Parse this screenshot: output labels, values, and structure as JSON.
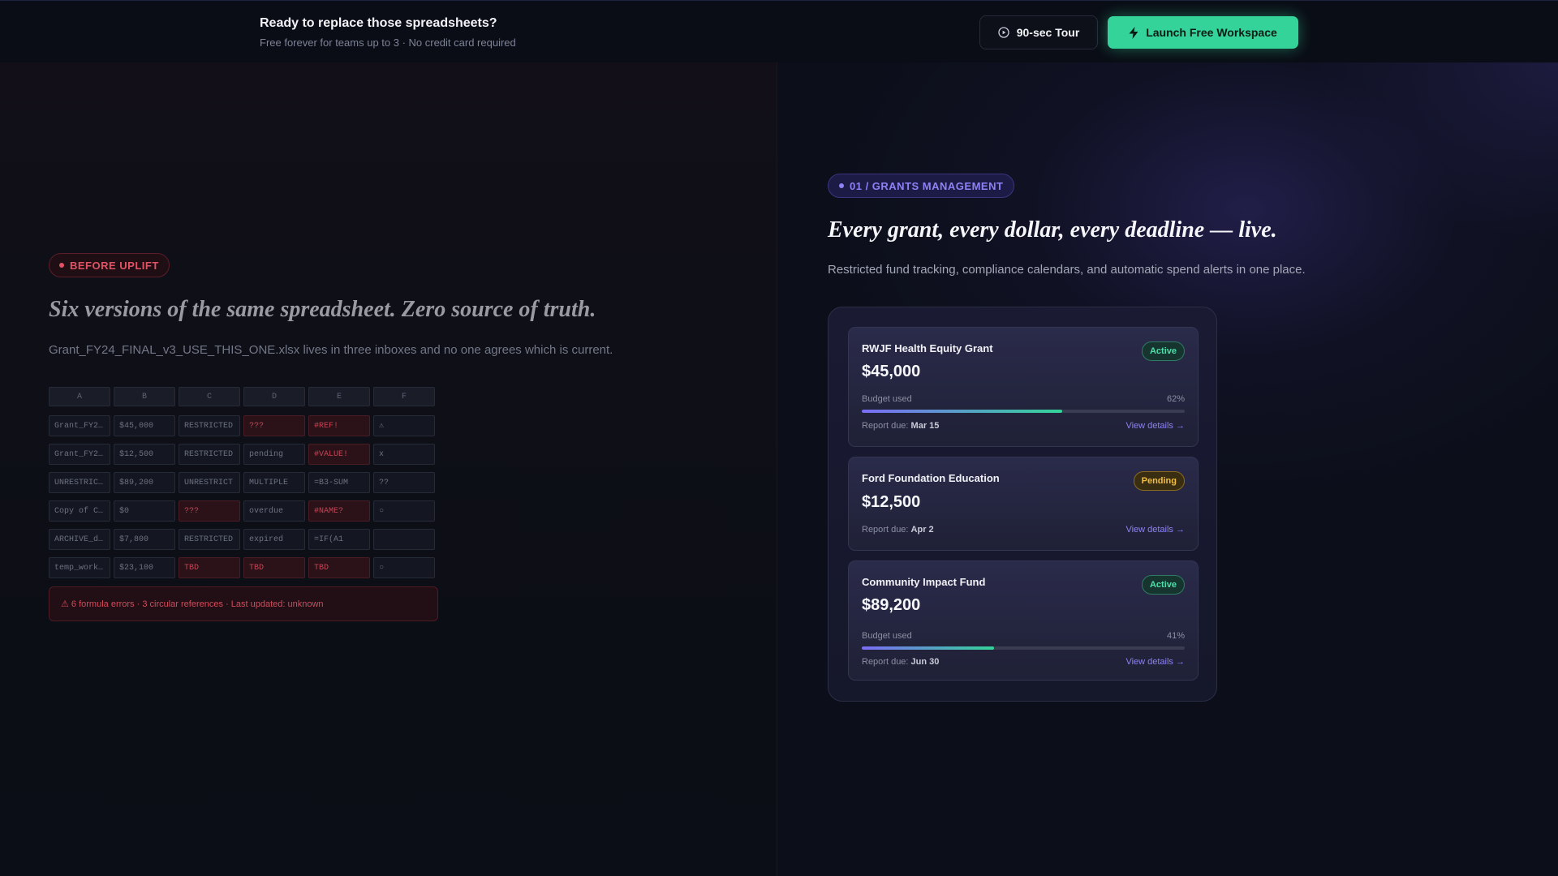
{
  "topbar": {
    "title": "Ready to replace those spreadsheets?",
    "subtitle": "Free forever for teams up to 3 · No credit card required",
    "tour_label": "90-sec Tour",
    "launch_label": "Launch Free Workspace",
    "accent": "#34d399"
  },
  "before": {
    "pill": "BEFORE UPLIFT",
    "heading": "Six versions of the same spreadsheet. Zero source of truth.",
    "body": "Grant_FY24_FINAL_v3_USE_THIS_ONE.xlsx lives in three inboxes and no one agrees which is current.",
    "columns": [
      "A",
      "B",
      "C",
      "D",
      "E",
      "F"
    ],
    "rows": [
      [
        "Grant_FY2…",
        "$45,000",
        "RESTRICTED",
        "???",
        "#REF!",
        "⚠"
      ],
      [
        "Grant_FY2…",
        "$12,500",
        "RESTRICTED",
        "pending",
        "#VALUE!",
        "x"
      ],
      [
        "UNRESTRIC…",
        "$89,200",
        "UNRESTRICT",
        "MULTIPLE",
        "=B3-SUM",
        "??"
      ],
      [
        "Copy of C…",
        "$0",
        "???",
        "overdue",
        "#NAME?",
        "○"
      ],
      [
        "ARCHIVE_d…",
        "$7,800",
        "RESTRICTED",
        "expired",
        "=IF(A1",
        ""
      ],
      [
        "temp_work…",
        "$23,100",
        "TBD",
        "TBD",
        "TBD",
        "○"
      ]
    ],
    "error_banner": "⚠ 6 formula errors · 3 circular references · Last updated: unknown",
    "color": "#e15263"
  },
  "after": {
    "pill": "01 / GRANTS MANAGEMENT",
    "heading": "Every grant, every dollar, every deadline — live.",
    "body": "Restricted fund tracking, compliance calendars, and automatic spend alerts in one place.",
    "color": "#8d82f5",
    "grants": [
      {
        "name": "RWJF Health Equity Grant",
        "amount": "$45,000",
        "status": "Active",
        "budget_label": "Budget used",
        "budget_pct": "62%",
        "budget_value": 0.62,
        "report_label": "Report due:",
        "report_date": "Mar 15",
        "link": "View details →"
      },
      {
        "name": "Ford Foundation Education",
        "amount": "$12,500",
        "status": "Pending",
        "report_label": "Report due:",
        "report_date": "Apr 2",
        "link": "View details →"
      },
      {
        "name": "Community Impact Fund",
        "amount": "$89,200",
        "status": "Active",
        "budget_label": "Budget used",
        "budget_pct": "41%",
        "budget_value": 0.41,
        "report_label": "Report due:",
        "report_date": "Jun 30",
        "link": "View details →"
      }
    ]
  }
}
